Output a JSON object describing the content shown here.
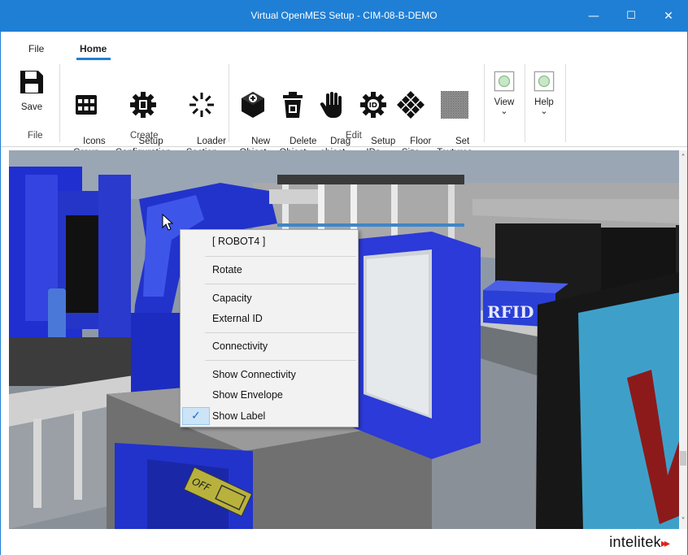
{
  "window": {
    "title": "Virtual OpenMES Setup  - CIM-08-B-DEMO",
    "controls": {
      "minimize": "—",
      "maximize": "☐",
      "close": "✕"
    }
  },
  "menu_tabs": [
    "File",
    "Home"
  ],
  "ribbon": {
    "file_group": {
      "label": "File",
      "buttons": [
        {
          "label": "Save",
          "icon": "save-icon"
        }
      ]
    },
    "create_group": {
      "label": "Create",
      "buttons": [
        {
          "label": "Icons\nGroup",
          "icon": "icons-group-icon"
        },
        {
          "label": "Setup\nConfiguration",
          "icon": "gear-icon"
        },
        {
          "label": "Loader\nSection",
          "icon": "loader-icon"
        }
      ]
    },
    "edit_group": {
      "label": "Edit",
      "buttons": [
        {
          "label": "New\nObject",
          "icon": "new-object-icon"
        },
        {
          "label": "Delete\nObject",
          "icon": "delete-icon"
        },
        {
          "label": "Drag\nobject",
          "icon": "hand-icon"
        },
        {
          "label": "Setup\nIDs",
          "icon": "id-gear-icon"
        },
        {
          "label": "Floor\nSize",
          "icon": "floor-icon"
        },
        {
          "label": "Set\nTextures",
          "icon": "texture-icon"
        }
      ]
    },
    "view": {
      "label": "View",
      "chevron": "⌄"
    },
    "help": {
      "label": "Help",
      "chevron": "⌄"
    }
  },
  "scene": {
    "rfid_label": "RFID",
    "off_label": "OFF"
  },
  "context_menu": {
    "items": [
      {
        "label": "[ ROBOT4 ]"
      },
      {
        "label": "Rotate"
      },
      {
        "label": "Capacity"
      },
      {
        "label": "External ID"
      },
      {
        "label": "Connectivity"
      },
      {
        "label": "Show Connectivity"
      },
      {
        "label": "Show Envelope"
      },
      {
        "label": "Show Label",
        "checked": true
      }
    ],
    "checkmark": "✓"
  },
  "status": {
    "logo": "intelitek",
    "logo_arrows": "▸▸"
  },
  "scroll": {
    "up": "˄",
    "down": "˅"
  },
  "colors": {
    "accent": "#1f7fd4",
    "robot_blue": "#2233cc",
    "rfid_blue": "#2a3fd6"
  }
}
